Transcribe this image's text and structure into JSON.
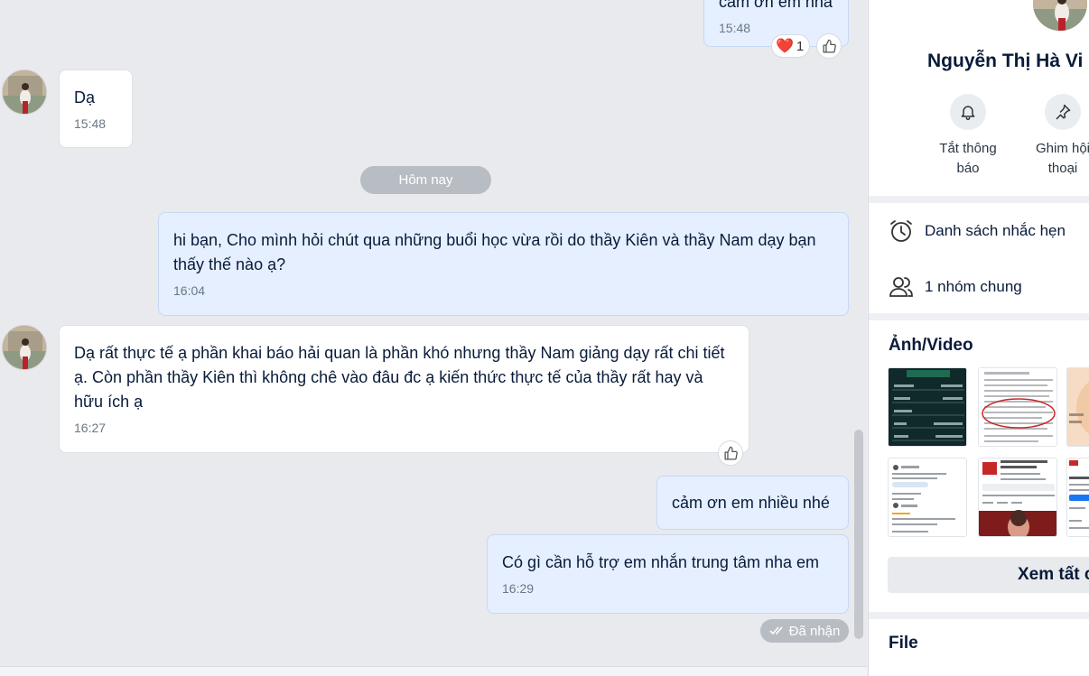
{
  "chat": {
    "messages": [
      {
        "sender": "me",
        "text": "cảm ơn em nha",
        "time": "15:48",
        "reaction": {
          "emoji": "❤️",
          "count": "1"
        }
      },
      {
        "sender": "contact",
        "text": "Dạ",
        "time": "15:48"
      },
      {
        "sender": "me",
        "text": "hi bạn, Cho mình hỏi chút qua những buổi học vừa rồi do thầy Kiên và thầy Nam dạy bạn thấy thế nào ạ?",
        "time": "16:04"
      },
      {
        "sender": "contact",
        "text": "Dạ rất thực tế ạ phần khai báo hải quan là phần khó nhưng thầy Nam giảng dạy rất chi tiết ạ. Còn phần thầy Kiên thì không chê vào đâu đc ạ kiến thức thực tế của thầy rất hay và hữu ích ạ",
        "time": "16:27"
      },
      {
        "sender": "me",
        "text": "cảm ơn em nhiều nhé",
        "time": ""
      },
      {
        "sender": "me",
        "text": "Có gì cần hỗ trợ em nhắn trung tâm nha em",
        "time": "16:29"
      }
    ],
    "date_separator": "Hôm nay",
    "status": "Đã nhận"
  },
  "panel": {
    "contact_name": "Nguyễn Thị Hà Vi",
    "actions": [
      {
        "label": "Tắt thông báo",
        "icon": "bell-icon"
      },
      {
        "label": "Ghim hội thoại",
        "icon": "pin-icon"
      }
    ],
    "reminders_label": "Danh sách nhắc hẹn",
    "groups_label": "1 nhóm chung",
    "media_title": "Ảnh/Video",
    "see_all_label": "Xem tất cả",
    "file_title": "File"
  },
  "colors": {
    "my_bubble": "#e5efff",
    "their_bubble": "#ffffff",
    "chat_background": "#e8eaee",
    "accent": "#0068ff"
  }
}
